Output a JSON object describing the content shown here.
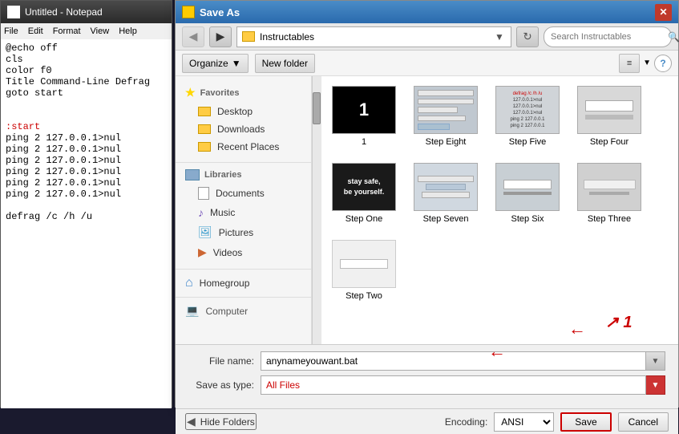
{
  "notepad": {
    "title": "Untitled - Notepad",
    "menu": [
      "File",
      "Edit",
      "Format",
      "View",
      "Help"
    ],
    "content_lines": [
      "@echo off",
      "cls",
      "color f0",
      "Title Command-Line Defrag",
      "goto start",
      "",
      "",
      ":start",
      "ping 2 127.0.0.1>nul",
      "ping 2 127.0.0.1>nul",
      "ping 2 127.0.0.1>nul",
      "ping 2 127.0.0.1>nul",
      "ping 2 127.0.0.1>nul",
      "ping 2 127.0.0.1>nul",
      "",
      "defrag /c /h /u"
    ]
  },
  "dialog": {
    "title": "Save As",
    "address": "Instructables",
    "search_placeholder": "Search Instructables",
    "toolbar": {
      "organize_label": "Organize",
      "new_folder_label": "New folder"
    },
    "nav": {
      "favorites_label": "Favorites",
      "desktop_label": "Desktop",
      "downloads_label": "Downloads",
      "recent_label": "Recent Places",
      "libraries_label": "Libraries",
      "documents_label": "Documents",
      "music_label": "Music",
      "pictures_label": "Pictures",
      "videos_label": "Videos",
      "homegroup_label": "Homegroup",
      "computer_label": "Computer"
    },
    "files": [
      {
        "name": "1",
        "thumb_type": "black_1"
      },
      {
        "name": "Step Eight",
        "thumb_type": "gray_grid"
      },
      {
        "name": "Step Five",
        "thumb_type": "gray_text"
      },
      {
        "name": "Step Four",
        "thumb_type": "light_bar"
      },
      {
        "name": "Step One",
        "thumb_type": "dark_stay"
      },
      {
        "name": "Step Seven",
        "thumb_type": "light_gray"
      },
      {
        "name": "Step Six",
        "thumb_type": "gray_bar"
      },
      {
        "name": "Step Three",
        "thumb_type": "light_bar2"
      },
      {
        "name": "Step Two",
        "thumb_type": "white_bar"
      }
    ],
    "bottom": {
      "filename_label": "File name:",
      "filename_value": "anynameyouwant.bat",
      "savetype_label": "Save as type:",
      "savetype_value": "All Files",
      "encoding_label": "Encoding:",
      "encoding_value": "ANSI",
      "save_label": "Save",
      "cancel_label": "Cancel",
      "hide_folders_label": "Hide Folders"
    }
  }
}
